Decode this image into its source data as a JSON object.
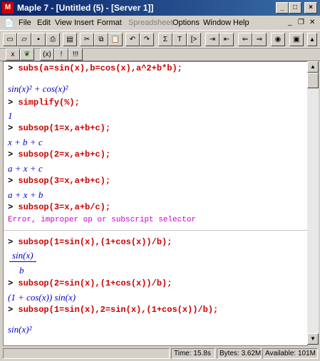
{
  "window": {
    "title": "Maple 7 - [Untitled (5) - [Server 1]]"
  },
  "menu": [
    "File",
    "Edit",
    "View",
    "Insert",
    "Format",
    "Spreadsheet",
    "Options",
    "Window",
    "Help"
  ],
  "worksheet": {
    "prompt": ">",
    "lines": [
      {
        "kind": "cmd",
        "text": "subs(a=sin(x),b=cos(x),a^2+b*b);"
      },
      {
        "kind": "out",
        "text": "sin(x)² + cos(x)²"
      },
      {
        "kind": "cmd",
        "text": "simplify(%);"
      },
      {
        "kind": "out",
        "text": "1"
      },
      {
        "kind": "cmd",
        "text": "subsop(1=x,a+b+c);"
      },
      {
        "kind": "out",
        "text": "x + b + c"
      },
      {
        "kind": "cmd",
        "text": "subsop(2=x,a+b+c);"
      },
      {
        "kind": "out",
        "text": "a + x + c"
      },
      {
        "kind": "cmd",
        "text": "subsop(3=x,a+b+c);"
      },
      {
        "kind": "out",
        "text": "a + x + b"
      },
      {
        "kind": "cmd",
        "text": "subsop(3=x,a+b/c);"
      },
      {
        "kind": "err",
        "text": "Error, improper op or subscript selector"
      },
      {
        "kind": "cmd",
        "text": "subsop(1=sin(x),(1+cos(x))/b);"
      },
      {
        "kind": "out",
        "text": "sin(x)"
      },
      {
        "kind": "out",
        "text": "b"
      },
      {
        "kind": "cmd",
        "text": "subsop(2=sin(x),(1+cos(x))/b);"
      },
      {
        "kind": "out",
        "text": "(1 + cos(x)) sin(x)"
      },
      {
        "kind": "cmd",
        "text": "subsop(1=sin(x),2=sin(x),(1+cos(x))/b);"
      },
      {
        "kind": "out",
        "text": "sin(x)²"
      }
    ]
  },
  "status": {
    "time": "Time: 15.8s",
    "bytes": "Bytes: 3.62M",
    "available": "Available: 101M"
  },
  "toolbar_icons": [
    "new-icon",
    "open-icon",
    "save-icon",
    "print-icon",
    "cut-icon",
    "copy-icon",
    "paste-icon",
    "undo-icon",
    "redo-icon",
    "sigma-icon",
    "text-icon",
    "prompt-icon",
    "indent-icon",
    "outdent-icon",
    "back-icon",
    "forward-icon",
    "stop-icon"
  ]
}
